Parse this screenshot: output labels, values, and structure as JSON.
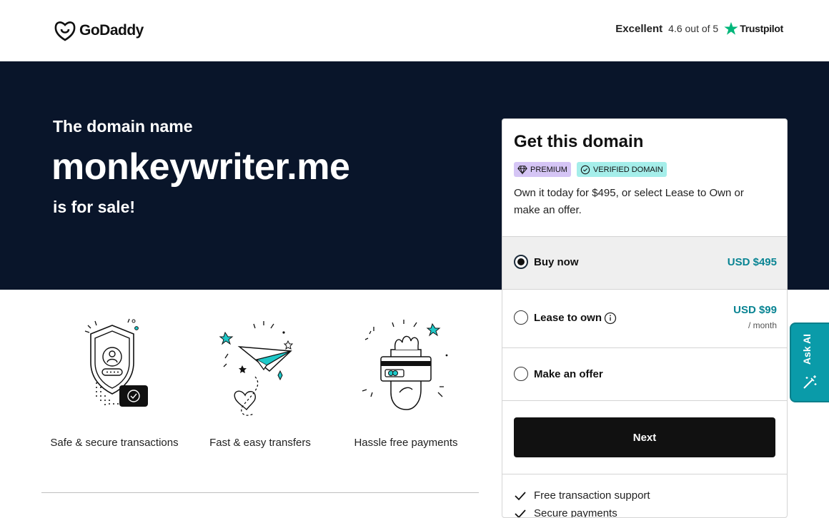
{
  "header": {
    "logo_text": "GoDaddy",
    "trustpilot": {
      "rating_word": "Excellent",
      "score": "4.6 out of 5",
      "brand": "Trustpilot"
    }
  },
  "hero": {
    "pre": "The domain name",
    "domain": "monkeywriter.me",
    "post": "is for sale!"
  },
  "features": [
    {
      "label": "Safe & secure transactions",
      "icon": "shield-icon"
    },
    {
      "label": "Fast & easy transfers",
      "icon": "paper-plane-icon"
    },
    {
      "label": "Hassle free payments",
      "icon": "card-payment-icon"
    }
  ],
  "card": {
    "title": "Get this domain",
    "badges": {
      "premium": "PREMIUM",
      "verified": "VERIFIED DOMAIN"
    },
    "description": "Own it today for $495, or select Lease to Own or make an offer.",
    "options": {
      "buy": {
        "label": "Buy now",
        "price": "USD $495",
        "selected": true
      },
      "lease": {
        "label": "Lease to own",
        "price": "USD $99",
        "sub": "/ month",
        "selected": false
      },
      "offer": {
        "label": "Make an offer",
        "selected": false
      }
    },
    "next_label": "Next",
    "perks": [
      "Free transaction support",
      "Secure payments"
    ]
  },
  "ask_ai": {
    "label": "Ask AI"
  },
  "colors": {
    "hero_bg": "#09152a",
    "accent_teal": "#098493",
    "ask_ai_bg": "#0a9ba9",
    "premium_badge": "#d5c5f5",
    "verified_badge": "#a5eeea"
  }
}
